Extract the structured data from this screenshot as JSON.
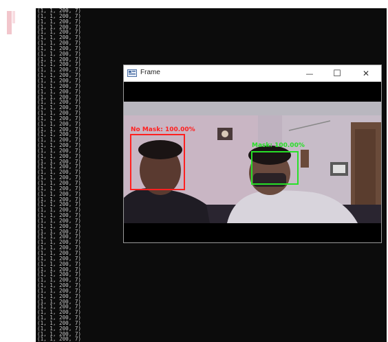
{
  "terminal": {
    "line_text": "(1, 1, 200, 7)",
    "line_count": 62
  },
  "window": {
    "title": "Frame",
    "minimize_label": "—",
    "maximize_label": "☐",
    "close_label": "✕"
  },
  "detections": [
    {
      "label": "No Mask: 100.00%",
      "color": "#ff2020"
    },
    {
      "label": "Mask: 100.00%",
      "color": "#28e028"
    }
  ]
}
